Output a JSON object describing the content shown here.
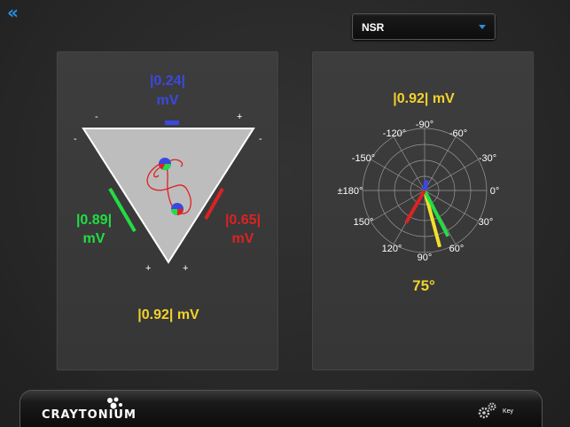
{
  "nav": {
    "back_icon": "double-chevron-left-icon",
    "back_glyph": "«"
  },
  "rhythm_select": {
    "value": "NSR"
  },
  "einthoven": {
    "lead_top_value": "|0.24|",
    "lead_top_unit": "mV",
    "lead_left_value": "|0.89|",
    "lead_left_unit": "mV",
    "lead_right_value": "|0.65|",
    "lead_right_unit": "mV",
    "net_amplitude": "|0.92| mV",
    "sign_top_left": "-",
    "sign_top_right": "+",
    "sign_left": "-",
    "sign_right": "-",
    "sign_bottom_left": "+",
    "sign_bottom_right": "+",
    "colors": {
      "lead_top": "#3b48e0",
      "lead_left": "#22dd44",
      "lead_right": "#dd2222",
      "net": "#f2d22c"
    }
  },
  "axis_wheel": {
    "amplitude": "|0.92| mV",
    "angle_labels": {
      "m90": "-90°",
      "m120": "-120°",
      "m60": "-60°",
      "m150": "-150°",
      "m30": "-30°",
      "p180": "±180°",
      "zero": "0°",
      "p150": "150°",
      "p30": "30°",
      "p120": "120°",
      "p60": "60°",
      "p90": "90°"
    },
    "axis_angle": "75°",
    "vectors": [
      {
        "lead": "net",
        "angle_deg": 75,
        "color": "#f2e02c"
      },
      {
        "lead": "II",
        "angle_deg": 63,
        "color": "#22dd44"
      },
      {
        "lead": "III",
        "angle_deg": 120,
        "color": "#dd2222"
      },
      {
        "lead": "I",
        "angle_deg": -80,
        "color": "#3b48e0"
      }
    ]
  },
  "footer": {
    "brand": "CRAYTONIUM",
    "key_label": "Key",
    "key_icon": "gears-icon"
  }
}
